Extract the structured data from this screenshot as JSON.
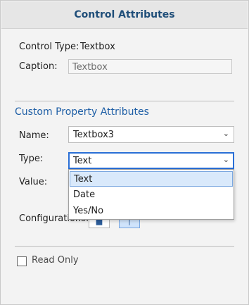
{
  "header": {
    "title": "Control Attributes"
  },
  "control": {
    "type_label": "Control Type:",
    "type_value": "Textbox",
    "caption_label": "Caption:",
    "caption_value": "Textbox"
  },
  "custom_property": {
    "section_title": "Custom Property Attributes",
    "name_label": "Name:",
    "name_value": "Textbox3",
    "type_label": "Type:",
    "type_value": "Text",
    "value_label": "Value:",
    "type_options": [
      "Text",
      "Date",
      "Yes/No"
    ],
    "configurations_label": "Configurations:"
  },
  "read_only": {
    "label": "Read Only"
  },
  "icons": {
    "dropdown": "chevron-down-icon",
    "config_a": "pin-icon",
    "config_b": "bar-icon"
  },
  "colors": {
    "header_text": "#1f4e79",
    "section_title": "#1f5fa6",
    "focus_border": "#2a6fd6",
    "selection_bg": "#d9e9fb"
  }
}
